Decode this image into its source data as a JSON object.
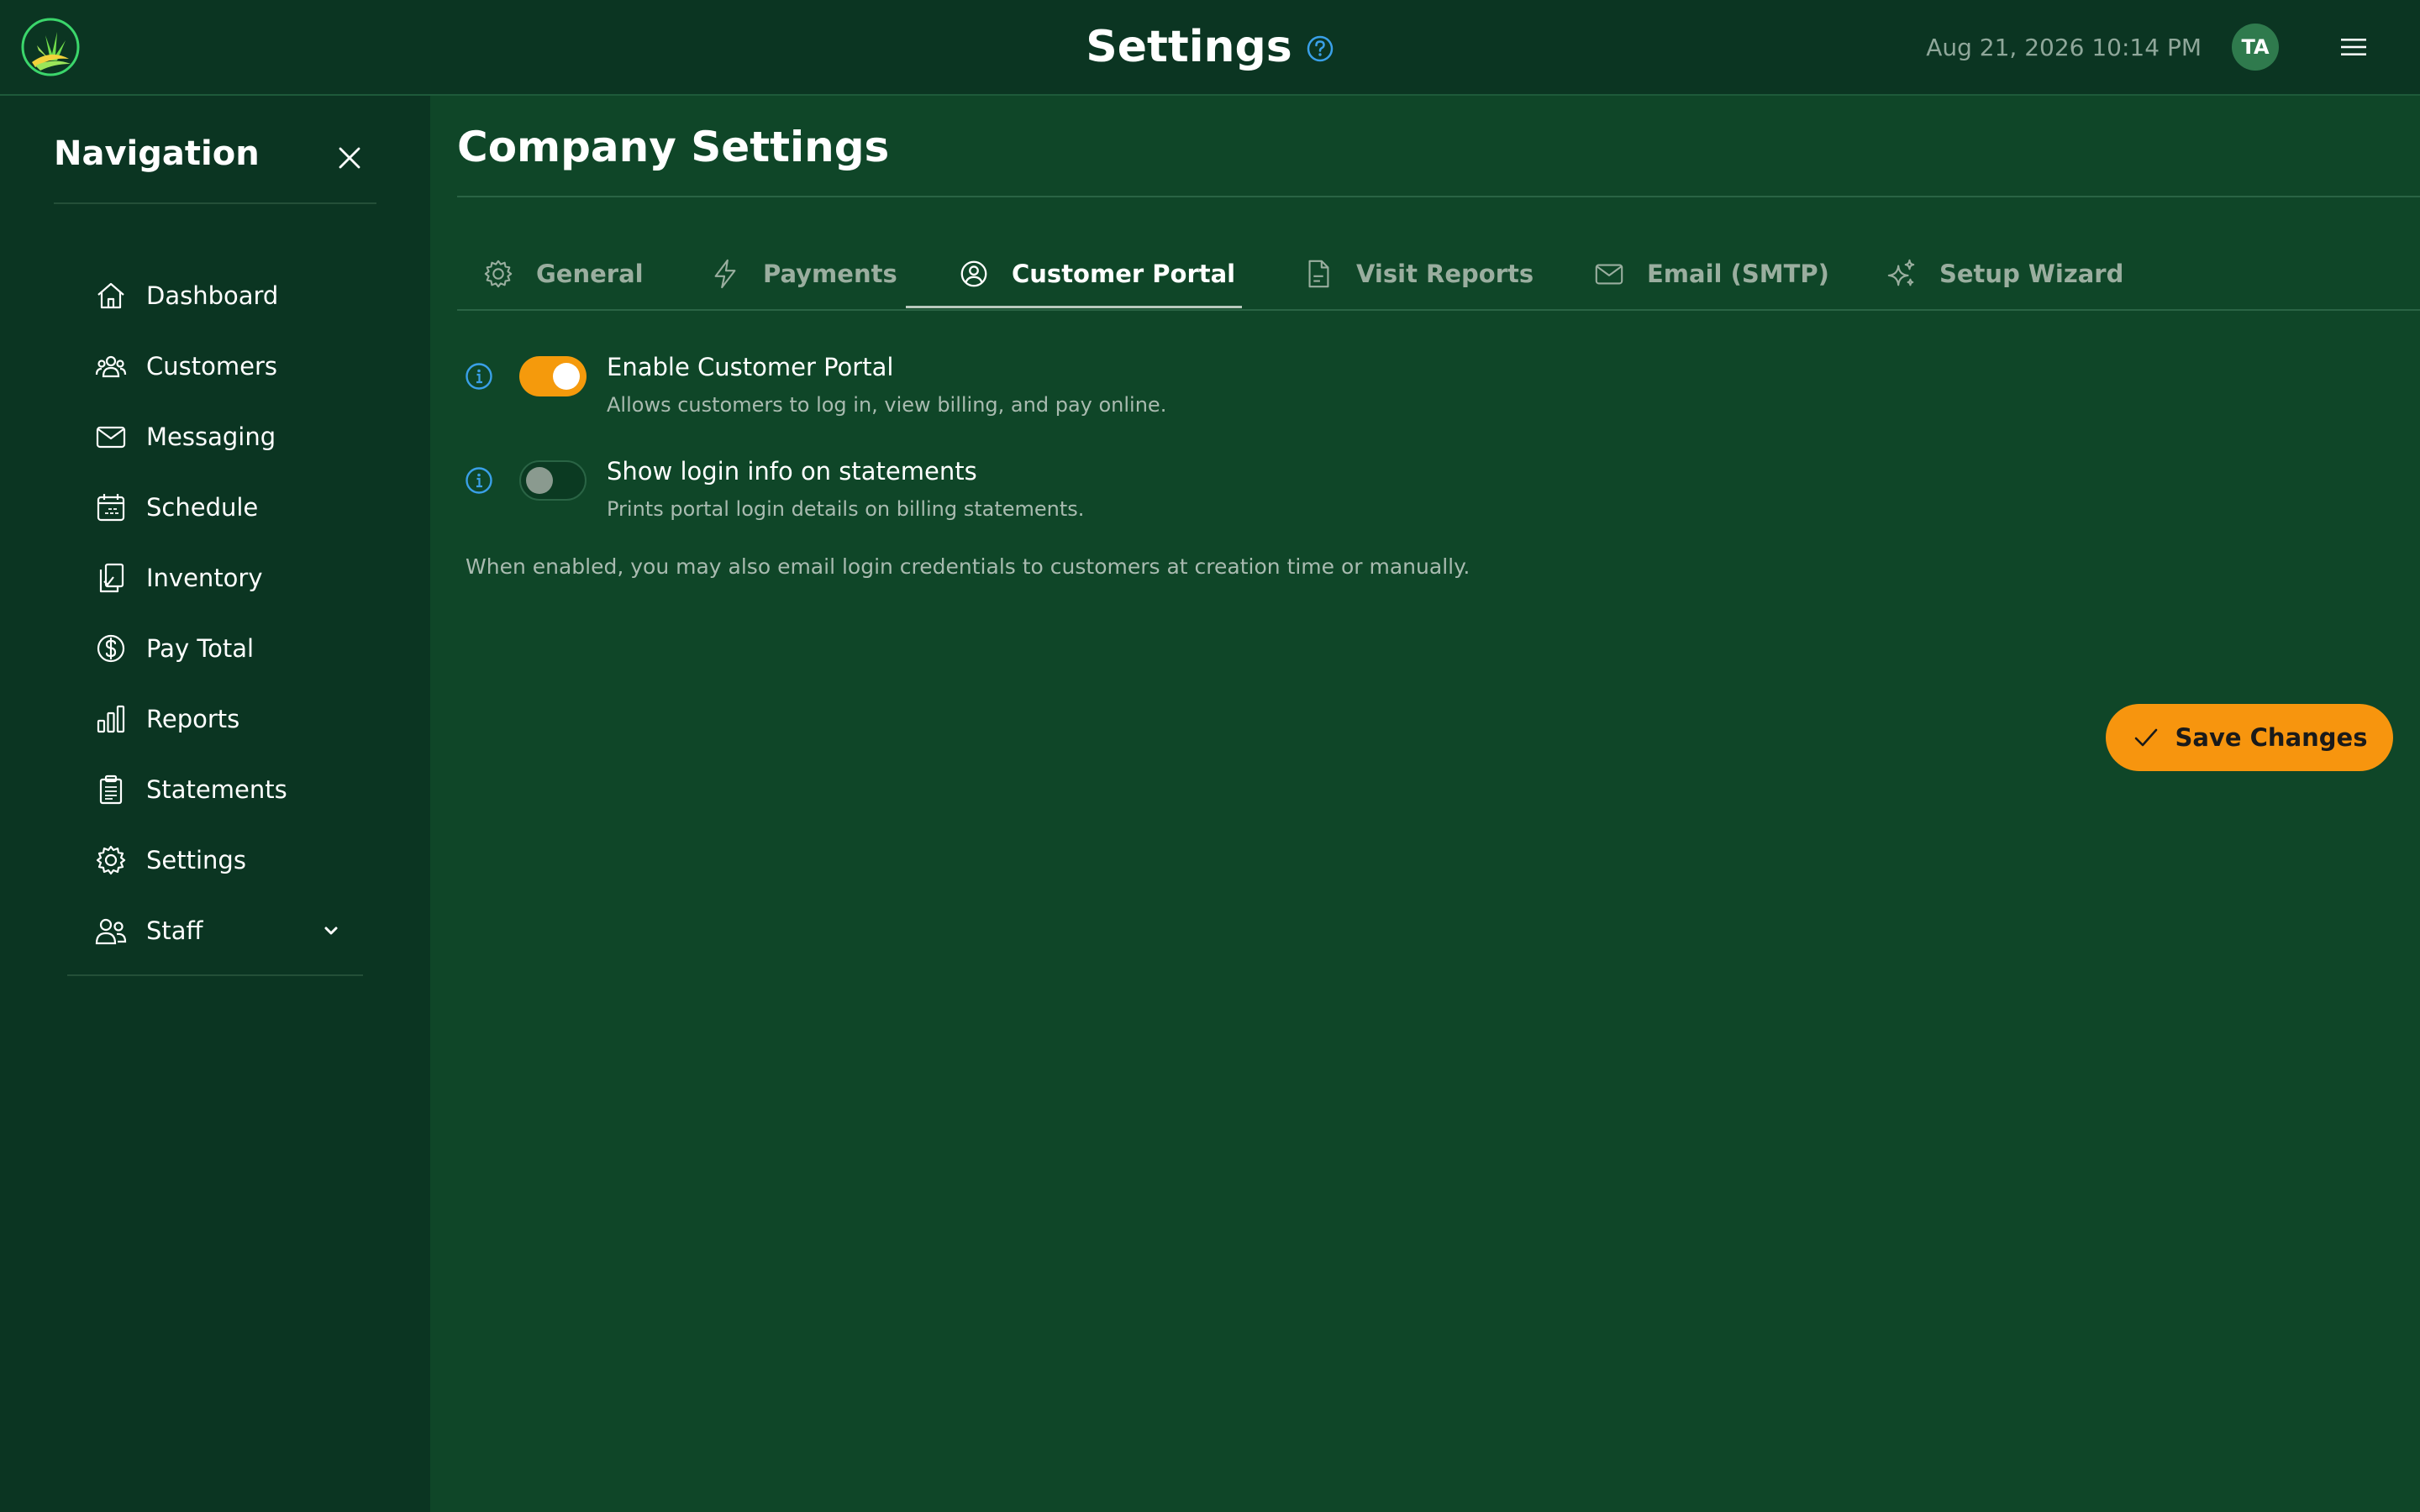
{
  "header": {
    "title": "Settings",
    "datetime": "Aug 21, 2026 10:14 PM",
    "avatar_initials": "TA",
    "logo_icon": "grass-logo-icon",
    "help_icon": "help-circle-icon",
    "menu_icon": "hamburger-menu-icon"
  },
  "sidebar": {
    "title": "Navigation",
    "close_icon": "close-icon",
    "items": [
      {
        "label": "Dashboard",
        "icon": "home-icon"
      },
      {
        "label": "Customers",
        "icon": "users-icon"
      },
      {
        "label": "Messaging",
        "icon": "mail-icon"
      },
      {
        "label": "Schedule",
        "icon": "calendar-icon"
      },
      {
        "label": "Inventory",
        "icon": "clipboard-check-icon"
      },
      {
        "label": "Pay Total",
        "icon": "dollar-circle-icon"
      },
      {
        "label": "Reports",
        "icon": "bar-chart-icon"
      },
      {
        "label": "Statements",
        "icon": "document-list-icon"
      },
      {
        "label": "Settings",
        "icon": "gear-icon"
      },
      {
        "label": "Staff",
        "icon": "staff-icon",
        "expandable": true
      }
    ]
  },
  "main": {
    "title": "Company Settings",
    "tabs": [
      {
        "label": "General",
        "icon": "gear-icon",
        "active": false
      },
      {
        "label": "Payments",
        "icon": "lightning-icon",
        "active": false
      },
      {
        "label": "Customer Portal",
        "icon": "user-circle-icon",
        "active": true
      },
      {
        "label": "Visit Reports",
        "icon": "document-icon",
        "active": false
      },
      {
        "label": "Email (SMTP)",
        "icon": "envelope-icon",
        "active": false
      },
      {
        "label": "Setup Wizard",
        "icon": "sparkles-icon",
        "active": false
      }
    ],
    "settings": [
      {
        "label": "Enable Customer Portal",
        "description": "Allows customers to log in, view billing, and pay online.",
        "enabled": true
      },
      {
        "label": "Show login info on statements",
        "description": "Prints portal login details on billing statements.",
        "enabled": false
      }
    ],
    "footnote": "When enabled, you may also email login credentials to customers at creation time or manually.",
    "save_label": "Save Changes"
  },
  "colors": {
    "background": "#0f4628",
    "header_bg": "#0b3522",
    "sidebar_bg": "#0b3522",
    "accent_orange": "#f7950e",
    "info_blue": "#3aa0e8",
    "muted_text": "#a9bbb0"
  }
}
